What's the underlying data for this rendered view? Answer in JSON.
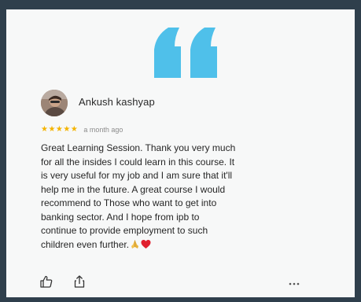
{
  "review": {
    "reviewer_name": "Ankush kashyap",
    "rating_stars": "★★★★★",
    "rating": 5,
    "time_ago": "a month ago",
    "text_lines": [
      "Great Learning Session. Thank you very much",
      "for all the insides I could learn in this course. It",
      "is very useful for my job and I am sure that it'll",
      "help me  in the future. A great course I would",
      "recommend to Those who want to get into",
      "banking sector. And I hope from ipb to",
      "continue to provide employment to such",
      "children even further."
    ],
    "more_label": "⋯"
  },
  "colors": {
    "background": "#2f3f4c",
    "card": "#f7f8f8",
    "quote_mark": "#4fc0ea",
    "star": "#f4b400"
  },
  "icons": {
    "quote": "quote-icon",
    "folded_hands": "folded-hands-emoji",
    "heart": "red-heart-emoji",
    "like": "thumbs-up-icon",
    "share": "share-icon",
    "more": "more-options-icon"
  }
}
